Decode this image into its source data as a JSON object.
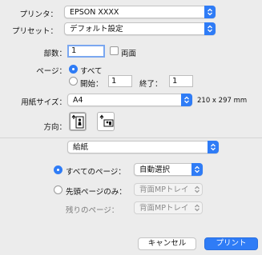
{
  "printer": {
    "label": "プリンタ：",
    "value": "EPSON XXXX"
  },
  "preset": {
    "label": "プリセット：",
    "value": "デフォルト設定"
  },
  "copies": {
    "label": "部数：",
    "value": "1",
    "duplex_label": "両面"
  },
  "pages": {
    "label": "ページ：",
    "all_label": "すべて",
    "from_label": "開始：",
    "from_value": "1",
    "to_label": "終了：",
    "to_value": "1"
  },
  "paper_size": {
    "label": "用紙サイズ：",
    "value": "A4",
    "dimensions": "210 x 297 mm"
  },
  "orientation": {
    "label": "方向："
  },
  "section_popup": {
    "value": "給紙"
  },
  "feed": {
    "all_pages_label": "すべてのページ：",
    "all_pages_value": "自動選択",
    "first_page_label": "先頭ページのみ：",
    "first_page_value": "背面MPトレイ",
    "remaining_label": "残りのページ：",
    "remaining_value": "背面MPトレイ"
  },
  "footer": {
    "cancel": "キャンセル",
    "print": "プリント"
  },
  "colors": {
    "accent": "#2f7cf6",
    "background": "#ececec"
  }
}
